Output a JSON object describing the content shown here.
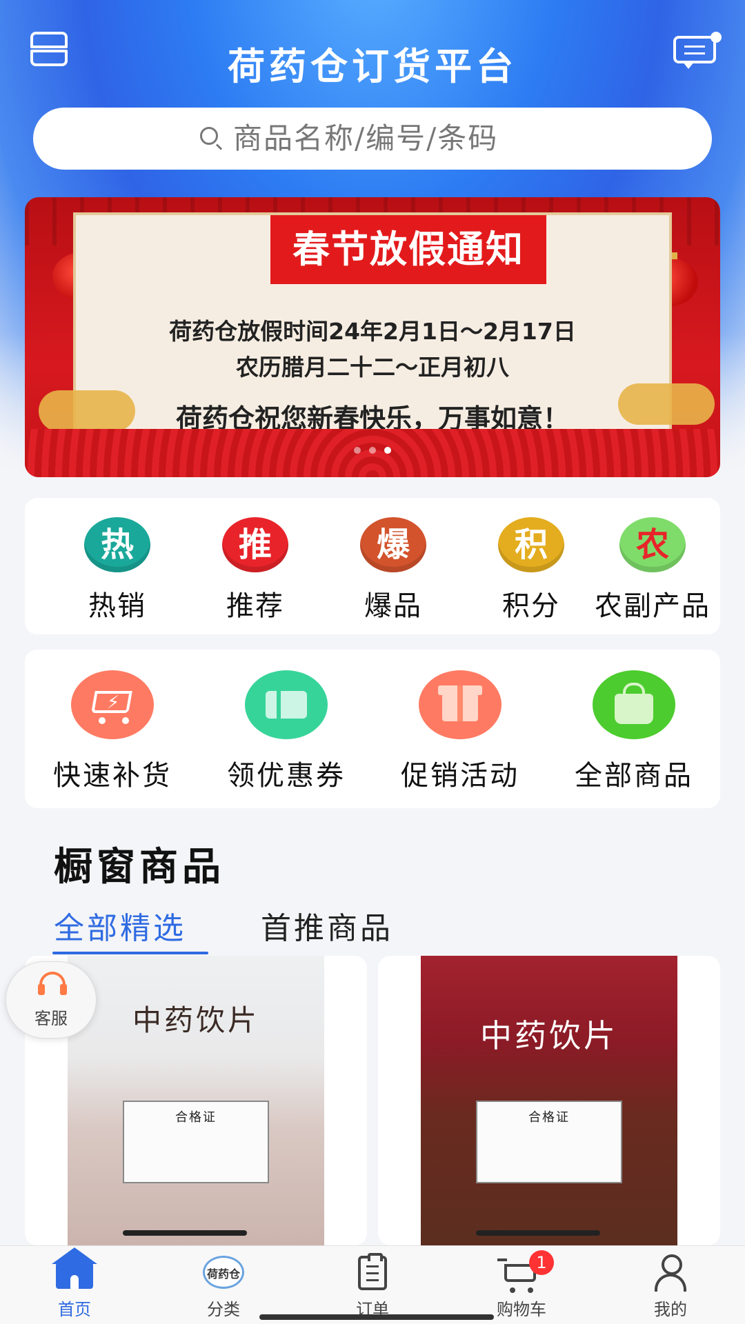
{
  "header": {
    "title": "荷药仓订货平台",
    "menu_icon": "menu-icon",
    "message_icon": "message-icon"
  },
  "search": {
    "placeholder": "商品名称/编号/条码"
  },
  "banner": {
    "title": "春节放假通知",
    "line1": "荷药仓放假时间24年2月1日～2月17日",
    "line2": "农历腊月二十二～正月初八",
    "line3": "荷药仓祝您新春快乐，万事如意！",
    "slide_count": 3,
    "active_slide": 3
  },
  "categories": [
    {
      "badge": "热",
      "label": "热销",
      "color": "#1aa89a"
    },
    {
      "badge": "推",
      "label": "推荐",
      "color": "#e8242a"
    },
    {
      "badge": "爆",
      "label": "爆品",
      "color": "#d2532c"
    },
    {
      "badge": "积",
      "label": "积分",
      "color": "#e4ad1f"
    },
    {
      "badge": "农",
      "label": "农副产品",
      "color": "#7fdc6a"
    }
  ],
  "activities": [
    {
      "label": "快速补货",
      "icon": "cart-bolt-icon",
      "color": "#ff7a62"
    },
    {
      "label": "领优惠券",
      "icon": "coupon-icon",
      "color": "#37d49a"
    },
    {
      "label": "促销活动",
      "icon": "gift-icon",
      "color": "#ff7a62"
    },
    {
      "label": "全部商品",
      "icon": "shopping-bag-icon",
      "color": "#4ccc2e"
    }
  ],
  "showcase": {
    "title": "橱窗商品",
    "tabs": [
      {
        "label": "全部精选",
        "active": true
      },
      {
        "label": "首推商品",
        "active": false
      }
    ]
  },
  "products": [
    {
      "package_text": "中药饮片",
      "cert_text": "合格证"
    },
    {
      "package_text": "中药饮片",
      "cert_text": "合格证"
    }
  ],
  "customer_service": {
    "label": "客服"
  },
  "tabbar": {
    "items": [
      {
        "label": "首页",
        "icon": "home-icon"
      },
      {
        "label": "分类",
        "icon": "brand-logo-icon",
        "logo_text": "荷药仓"
      },
      {
        "label": "订单",
        "icon": "order-clipboard-icon"
      },
      {
        "label": "购物车",
        "icon": "cart-icon",
        "badge": "1"
      },
      {
        "label": "我的",
        "icon": "user-icon"
      }
    ]
  },
  "colors": {
    "accent": "#2f6be2",
    "header_blue": "#2d7cf3",
    "badge_red": "#ff3333"
  }
}
